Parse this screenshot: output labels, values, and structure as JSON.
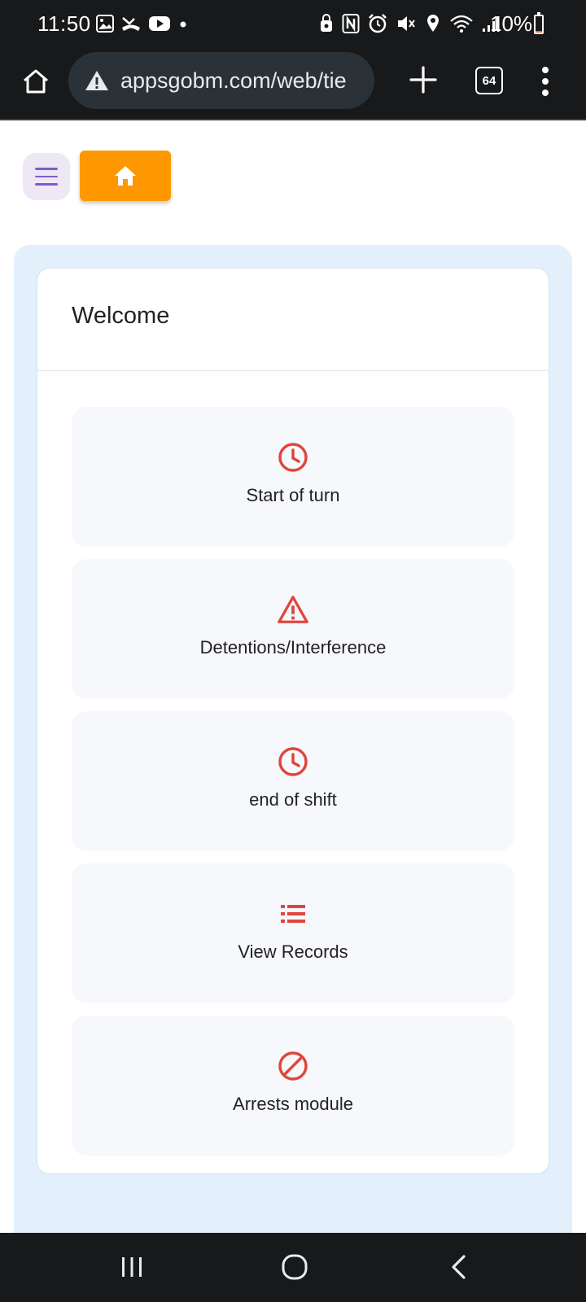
{
  "status_bar": {
    "time": "11:50",
    "battery_percent": "10%",
    "battery_level": 0.1,
    "icons_left": [
      "gallery-icon",
      "missed-call-icon",
      "youtube-icon",
      "notification-dot-icon"
    ],
    "icons_right": [
      "vpn-icon",
      "nfc-icon",
      "alarm-icon",
      "mute-icon",
      "location-icon",
      "wifi-icon",
      "signal-icon"
    ]
  },
  "browser": {
    "url": "appsgobm.com/web/tie",
    "security_icon": "warning-icon",
    "tab_count": "64"
  },
  "toolbar": {
    "menu_icon": "hamburger-icon",
    "home_icon": "home-icon",
    "home_button_color": "#ff9800"
  },
  "card": {
    "title": "Welcome"
  },
  "tiles": [
    {
      "label": "Start of turn",
      "icon": "clock-icon"
    },
    {
      "label": "Detentions/Interference",
      "icon": "warning-triangle-icon"
    },
    {
      "label": "end of shift",
      "icon": "clock-icon"
    },
    {
      "label": "View Records",
      "icon": "list-icon"
    },
    {
      "label": "Arrests module",
      "icon": "ban-icon"
    }
  ],
  "colors": {
    "icon_red": "#e0463c",
    "panel_bg": "#e3effb",
    "tile_bg": "#f6f8fc"
  },
  "nav_bar": {
    "buttons": [
      "recents-icon",
      "home-circle-icon",
      "back-icon"
    ]
  }
}
